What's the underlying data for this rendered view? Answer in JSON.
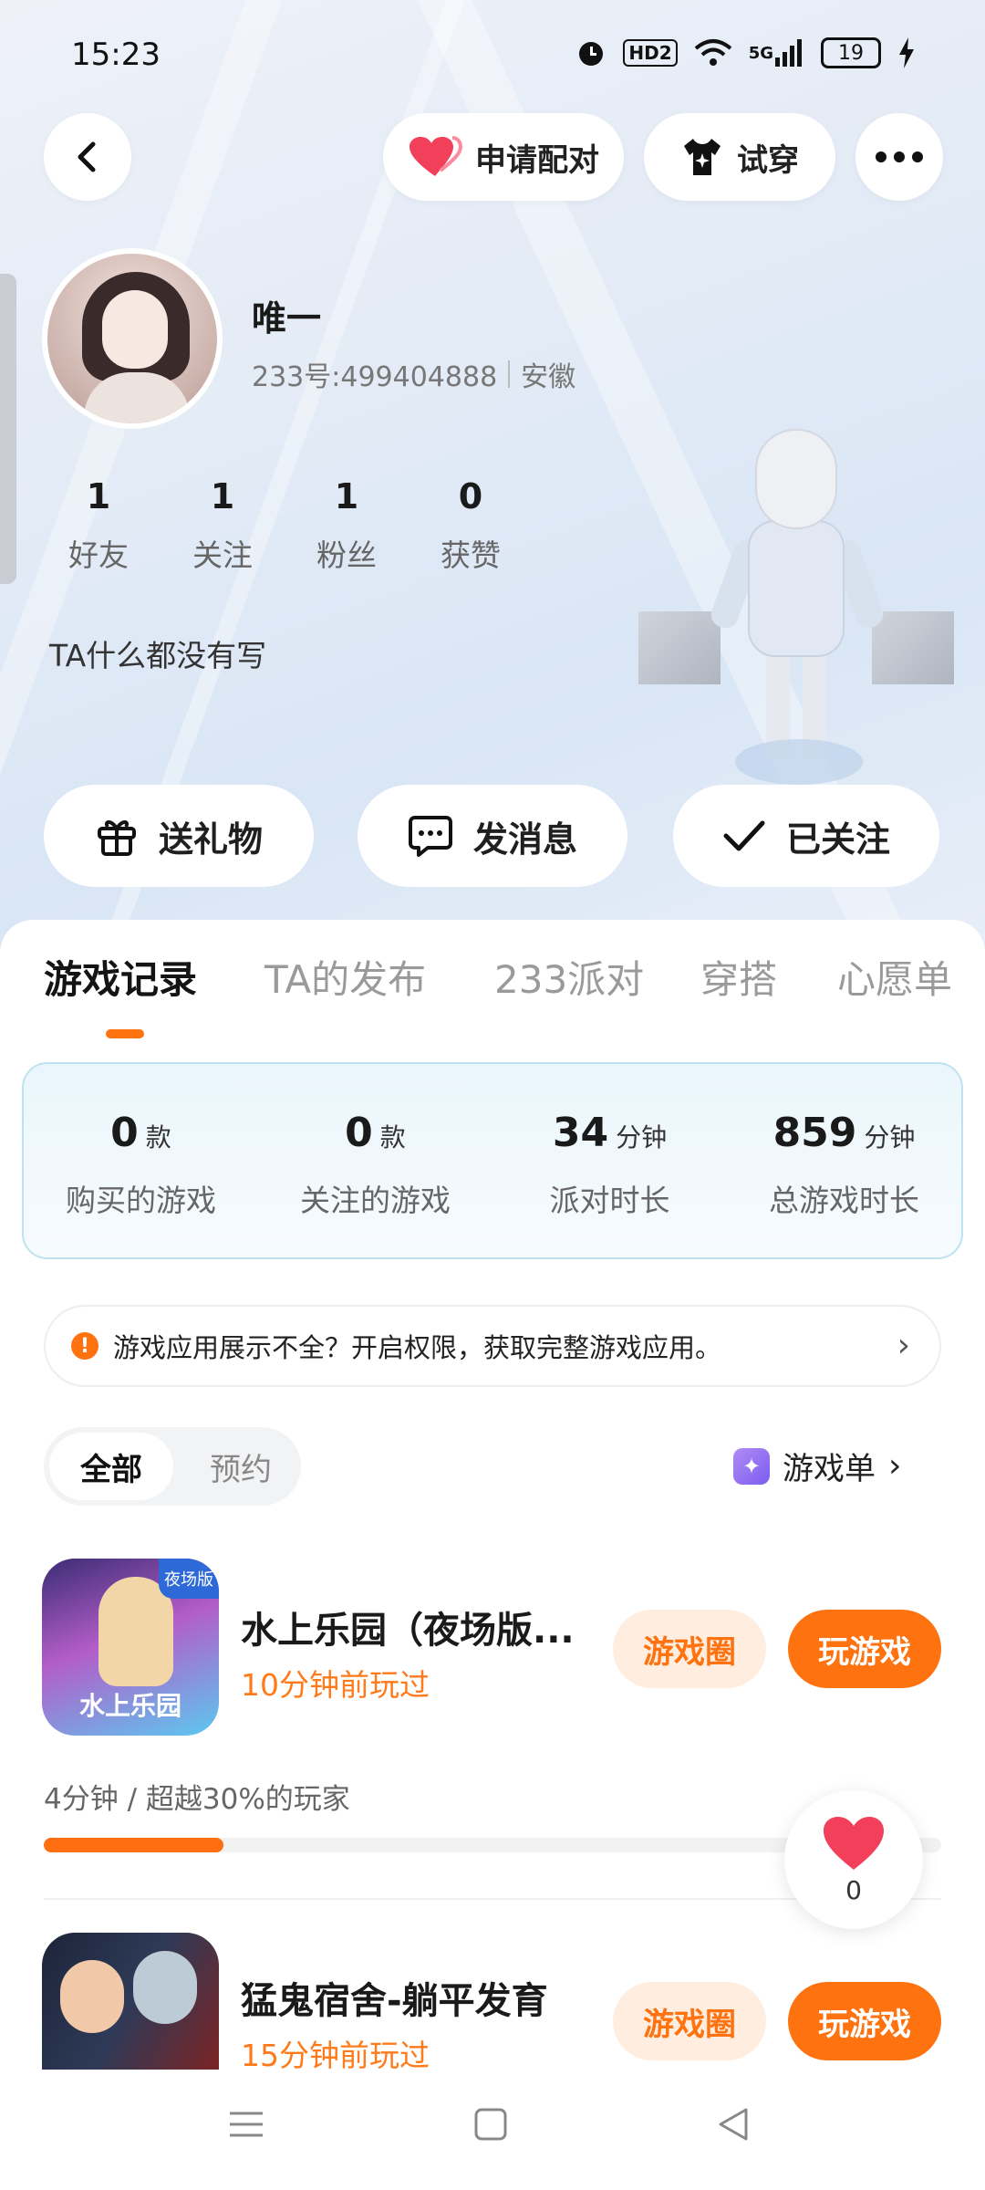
{
  "status_bar": {
    "time": "15:23",
    "hd": "HD2",
    "network": "5G",
    "battery": "19"
  },
  "header": {
    "pair_label": "申请配对",
    "try_on_label": "试穿"
  },
  "profile": {
    "nickname": "唯一",
    "uid": "233号:499404888",
    "location": "安徽",
    "bio": "TA什么都没有写",
    "stats": [
      {
        "value": "1",
        "label": "好友"
      },
      {
        "value": "1",
        "label": "关注"
      },
      {
        "value": "1",
        "label": "粉丝"
      },
      {
        "value": "0",
        "label": "获赞"
      }
    ]
  },
  "actions": {
    "gift": "送礼物",
    "message": "发消息",
    "followed": "已关注"
  },
  "tabs": [
    "游戏记录",
    "TA的发布",
    "233派对",
    "穿搭",
    "心愿单"
  ],
  "summary": [
    {
      "value": "0",
      "unit": "款",
      "label": "购买的游戏"
    },
    {
      "value": "0",
      "unit": "款",
      "label": "关注的游戏"
    },
    {
      "value": "34",
      "unit": "分钟",
      "label": "派对时长"
    },
    {
      "value": "859",
      "unit": "分钟",
      "label": "总游戏时长"
    }
  ],
  "notice": {
    "text": "游戏应用展示不全？开启权限，获取完整游戏应用。"
  },
  "filter": {
    "all": "全部",
    "reserve": "预约",
    "game_list": "游戏单"
  },
  "games": [
    {
      "title": "水上乐园（夜场版...",
      "last_played": "10分钟前玩过",
      "icon_label": "水上乐园",
      "icon_badge": "夜场版",
      "circle_label": "游戏圈",
      "play_label": "玩游戏",
      "progress_text": "4分钟 / 超越30%的玩家",
      "progress_fraction": 0.2
    },
    {
      "title": "猛鬼宿舍-躺平发育",
      "last_played": "15分钟前玩过",
      "circle_label": "游戏圈",
      "play_label": "玩游戏"
    }
  ],
  "like_bubble": {
    "count": "0"
  },
  "colors": {
    "accent": "#ff7210",
    "heart": "#f2405a"
  }
}
